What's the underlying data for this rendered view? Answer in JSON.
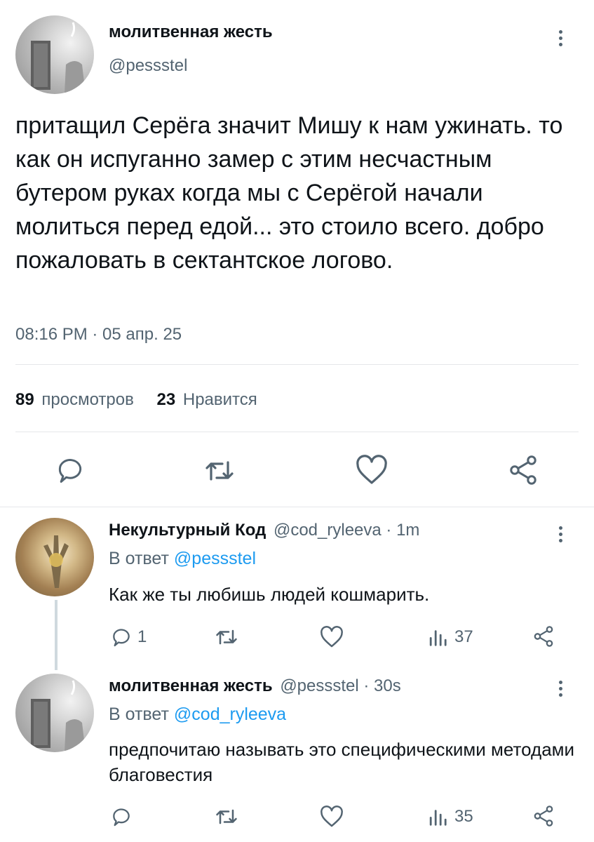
{
  "main_tweet": {
    "author_name": "молитвенная жесть",
    "handle": "@pessstel",
    "text": "притащил Серёга значит Мишу к нам ужинать. то как он испуганно замер с этим несчастным бутером руках когда мы с Серёгой начали молиться перед едой... это стоило всего. добро пожаловать в сектантское логово.",
    "timestamp": "08:16 PM · 05 апр. 25",
    "stats": {
      "views_count": "89",
      "views_label": "просмотров",
      "likes_count": "23",
      "likes_label": "Нравится"
    },
    "actions": [
      "reply-icon",
      "retweet-icon",
      "like-icon",
      "share-icon"
    ]
  },
  "replies": [
    {
      "author_name": "Некультурный Код",
      "meta": "@cod_ryleeva · 1m",
      "reply_to_prefix": "В ответ",
      "reply_to_handle": "@pessstel",
      "text": "Как же ты любишь людей кошмарить.",
      "reply_count": "1",
      "views_count": "37"
    },
    {
      "author_name": "молитвенная жесть",
      "meta": "@pessstel · 30s",
      "reply_to_prefix": "В ответ",
      "reply_to_handle": "@cod_ryleeva",
      "text": "предпочитаю называть это специфическими методами благовестия",
      "reply_count": "",
      "views_count": "35"
    }
  ],
  "colors": {
    "text": "#0f1419",
    "secondary": "#536471",
    "link": "#1d9bf0",
    "divider": "#e5e7ea"
  }
}
